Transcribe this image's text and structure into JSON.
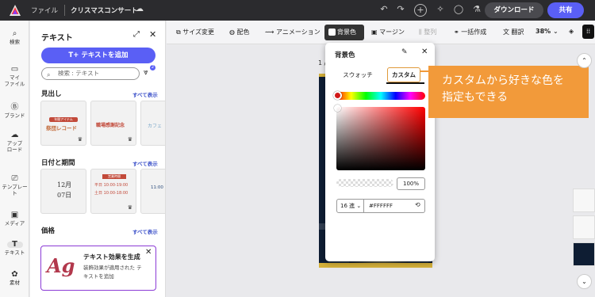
{
  "topbar": {
    "file_label": "ファイル",
    "doc_title": "クリスマスコンサート",
    "download_label": "ダウンロード",
    "share_label": "共有"
  },
  "rail": {
    "items": [
      {
        "label": "検索",
        "icon": "search-icon",
        "glyph": "⌕"
      },
      {
        "label": "マイ\nファイル",
        "icon": "folder-icon",
        "glyph": "▭"
      },
      {
        "label": "ブランド",
        "icon": "brand-icon",
        "glyph": "B"
      },
      {
        "label": "アップ\nロード",
        "icon": "upload-icon",
        "glyph": "☁"
      },
      {
        "label": "テンプレート",
        "icon": "template-icon",
        "glyph": "⎚"
      },
      {
        "label": "メディア",
        "icon": "media-icon",
        "glyph": "▣"
      },
      {
        "label": "テキスト",
        "icon": "text-icon",
        "glyph": "T"
      },
      {
        "label": "素材",
        "icon": "elements-icon",
        "glyph": "✿"
      }
    ]
  },
  "panel": {
    "title": "テキスト",
    "add_text_label": "テキストを追加",
    "search_placeholder": "検索 : テキスト",
    "filter_count": "2",
    "sections": [
      {
        "heading": "見出し",
        "see_all": "すべて表示"
      },
      {
        "heading": "日付と期間",
        "see_all": "すべて表示"
      },
      {
        "heading": "価格",
        "see_all": "すべて表示"
      }
    ],
    "card_texts": {
      "h1": "年間アイテム",
      "h1b": "祭団レコード",
      "h2": "職場感謝記念",
      "h3": "カフェ",
      "d1a": "12月",
      "d1b": "07日",
      "d2a": "営業時間",
      "d2b": "平日 10:00-19:00",
      "d2c": "土日 10:00-18:00",
      "d3": "11:00"
    },
    "promo": {
      "badge": "Ag",
      "title": "テキスト効果を生成",
      "desc": "装飾効果が適用された テキストを追加"
    }
  },
  "toolbar": {
    "items": [
      {
        "label": "サイズ変更",
        "icon": "resize-icon"
      },
      {
        "label": "配色",
        "icon": "palette-icon"
      },
      {
        "label": "アニメーション",
        "icon": "animation-icon"
      },
      {
        "label": "背景色",
        "icon": "bg-color-icon"
      },
      {
        "label": "マージン",
        "icon": "margin-icon"
      },
      {
        "label": "整列",
        "icon": "align-icon"
      },
      {
        "label": "一括作成",
        "icon": "bulk-create-icon"
      },
      {
        "label": "翻訳",
        "icon": "translate-icon"
      }
    ],
    "zoom": "38%"
  },
  "canvas": {
    "page_label": "1 /"
  },
  "color_popover": {
    "title": "背景色",
    "tab_swatch": "スウォッチ",
    "tab_custom": "カスタム",
    "opacity": "100%",
    "format": "16 進",
    "hex_value": "#FFFFFF",
    "accent": "#f29a3a"
  },
  "callout": {
    "line1": "カスタムから好きな色を",
    "line2": "指定もできる"
  },
  "colors": {
    "brand": "#5a5ff5",
    "topbar": "#2b2b2e",
    "callout": "#f29a3a"
  }
}
